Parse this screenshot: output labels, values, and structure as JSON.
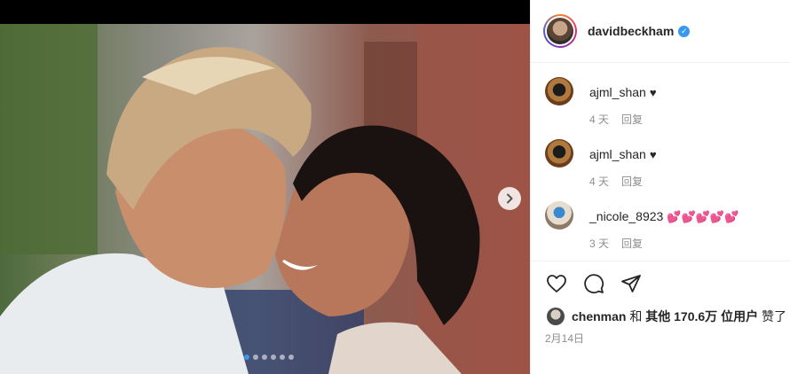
{
  "post": {
    "username": "davidbeckham",
    "verified_mark": "✓",
    "carousel": {
      "slide_count": 6,
      "active_slide": 1
    }
  },
  "comments": [
    {
      "username": "ajml_shan",
      "text": "♥",
      "time": "4 天",
      "reply": "回复"
    },
    {
      "username": "ajml_shan",
      "text": "♥",
      "time": "4 天",
      "reply": "回复"
    },
    {
      "username": "_nicole_8923",
      "text": "💕💕💕💕💕",
      "time": "3 天",
      "reply": "回复"
    }
  ],
  "actions": {
    "like_icon": "heart-outline-icon",
    "comment_icon": "comment-bubble-icon",
    "share_icon": "paper-plane-icon"
  },
  "likes": {
    "user": "chenman",
    "connector": " 和 ",
    "others": "其他 170.6万 位用户",
    "suffix": " 赞了"
  },
  "date": "2月14日",
  "colors": {
    "accent": "#3897f0",
    "meta_text": "#8e8e8e"
  }
}
